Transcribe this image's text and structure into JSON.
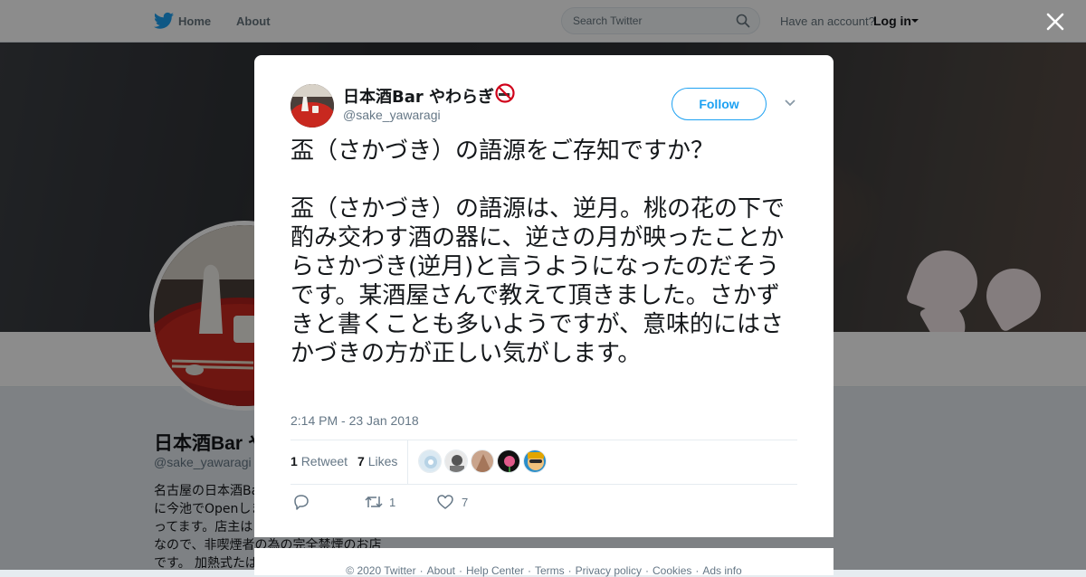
{
  "topbar": {
    "nav": [
      {
        "label": "Home",
        "icon": "bird-icon"
      },
      {
        "label": "About"
      }
    ],
    "search_placeholder": "Search Twitter",
    "account_prompt": "Have an account?",
    "login_label": "Log in"
  },
  "profile": {
    "name": "日本酒Bar やわらぎ",
    "handle": "@sake_yawaragi",
    "bio_lines": [
      "名古屋の日本酒Ba",
      "に今池でOpenしま",
      "ってます。店主は",
      "なので、非喫煙者の為の完全禁煙のお店",
      "です。 加熱式たば"
    ]
  },
  "tweet": {
    "author_name": "日本酒Bar やわらぎ",
    "author_handle": "@sake_yawaragi",
    "author_badge_icon": "no-smoking-icon",
    "follow_label": "Follow",
    "text": "盃（さかづき）の語源をご存知ですか？\n\n盃（さかづき）の語源は、逆月。桃の花の下で酌み交わす酒の器に、逆さの月が映ったことからさかづき(逆月)と言うようになったのだそうです。某酒屋さんで教えて頂きました。さかずきと書くことも多いようですが、意味的にはさかづきの方が正しい気がします。",
    "timestamp": "2:14 PM - 23 Jan 2018",
    "retweet_count": "1",
    "retweet_label": "Retweet",
    "like_count": "7",
    "like_label": "Likes",
    "action_retweet_count": "1",
    "action_like_count": "7"
  },
  "footer": {
    "links": [
      "© 2020 Twitter",
      "About",
      "Help Center",
      "Terms",
      "Privacy policy",
      "Cookies",
      "Ads info"
    ]
  },
  "colors": {
    "accent": "#1da1f2",
    "text": "#14171a",
    "muted": "#657786"
  }
}
